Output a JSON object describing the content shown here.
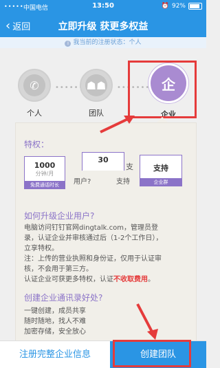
{
  "status_bar": {
    "signal": "•••••",
    "carrier": "中国电信",
    "time": "13:50",
    "battery": "92%"
  },
  "nav": {
    "back_label": "返回",
    "title": "立即升级 获更多权益"
  },
  "sub_status": "我当前的注册状态：个人",
  "steps": [
    {
      "label": "个人",
      "icon": "phone-icon"
    },
    {
      "label": "团队",
      "icon": "team-icon"
    },
    {
      "label": "企业",
      "icon_text": "企"
    }
  ],
  "privileges": {
    "title": "特权：",
    "cards": [
      {
        "big": "1000",
        "small": "分钟/月",
        "tag": "免费通话时长"
      },
      {
        "big": "30",
        "small": "",
        "tag": ""
      },
      {
        "big": "支持",
        "small": "",
        "tag": "企业群"
      }
    ],
    "fragments": {
      "users": "用户?",
      "zhi": "支",
      "support": "支持"
    }
  },
  "upgrade": {
    "title": "如何升级企业用户?",
    "lines": [
      "电脑访问钉钉官网dingtalk.com，管理员登",
      "录，认证企业并审核通过后（1-2个工作日），",
      "立享特权。",
      "注：上传的营业执照和身份证，仅用于认证审",
      "核，不会用于第三方。"
    ],
    "charge_prefix": "认证企业可获更多特权，认证",
    "charge_red": "不收取费用",
    "charge_suffix": "。"
  },
  "contacts": {
    "title": "创建企业通讯录好处?",
    "lines": [
      "一键创建，成员共享",
      "随时随地，找人不难",
      "加密存储，安全放心"
    ]
  },
  "bottom": {
    "left_label": "注册完整企业信息",
    "right_label": "创建团队"
  },
  "colors": {
    "accent": "#2a95e4",
    "purple": "#8b73c8",
    "annotation_red": "#e53b3b"
  }
}
